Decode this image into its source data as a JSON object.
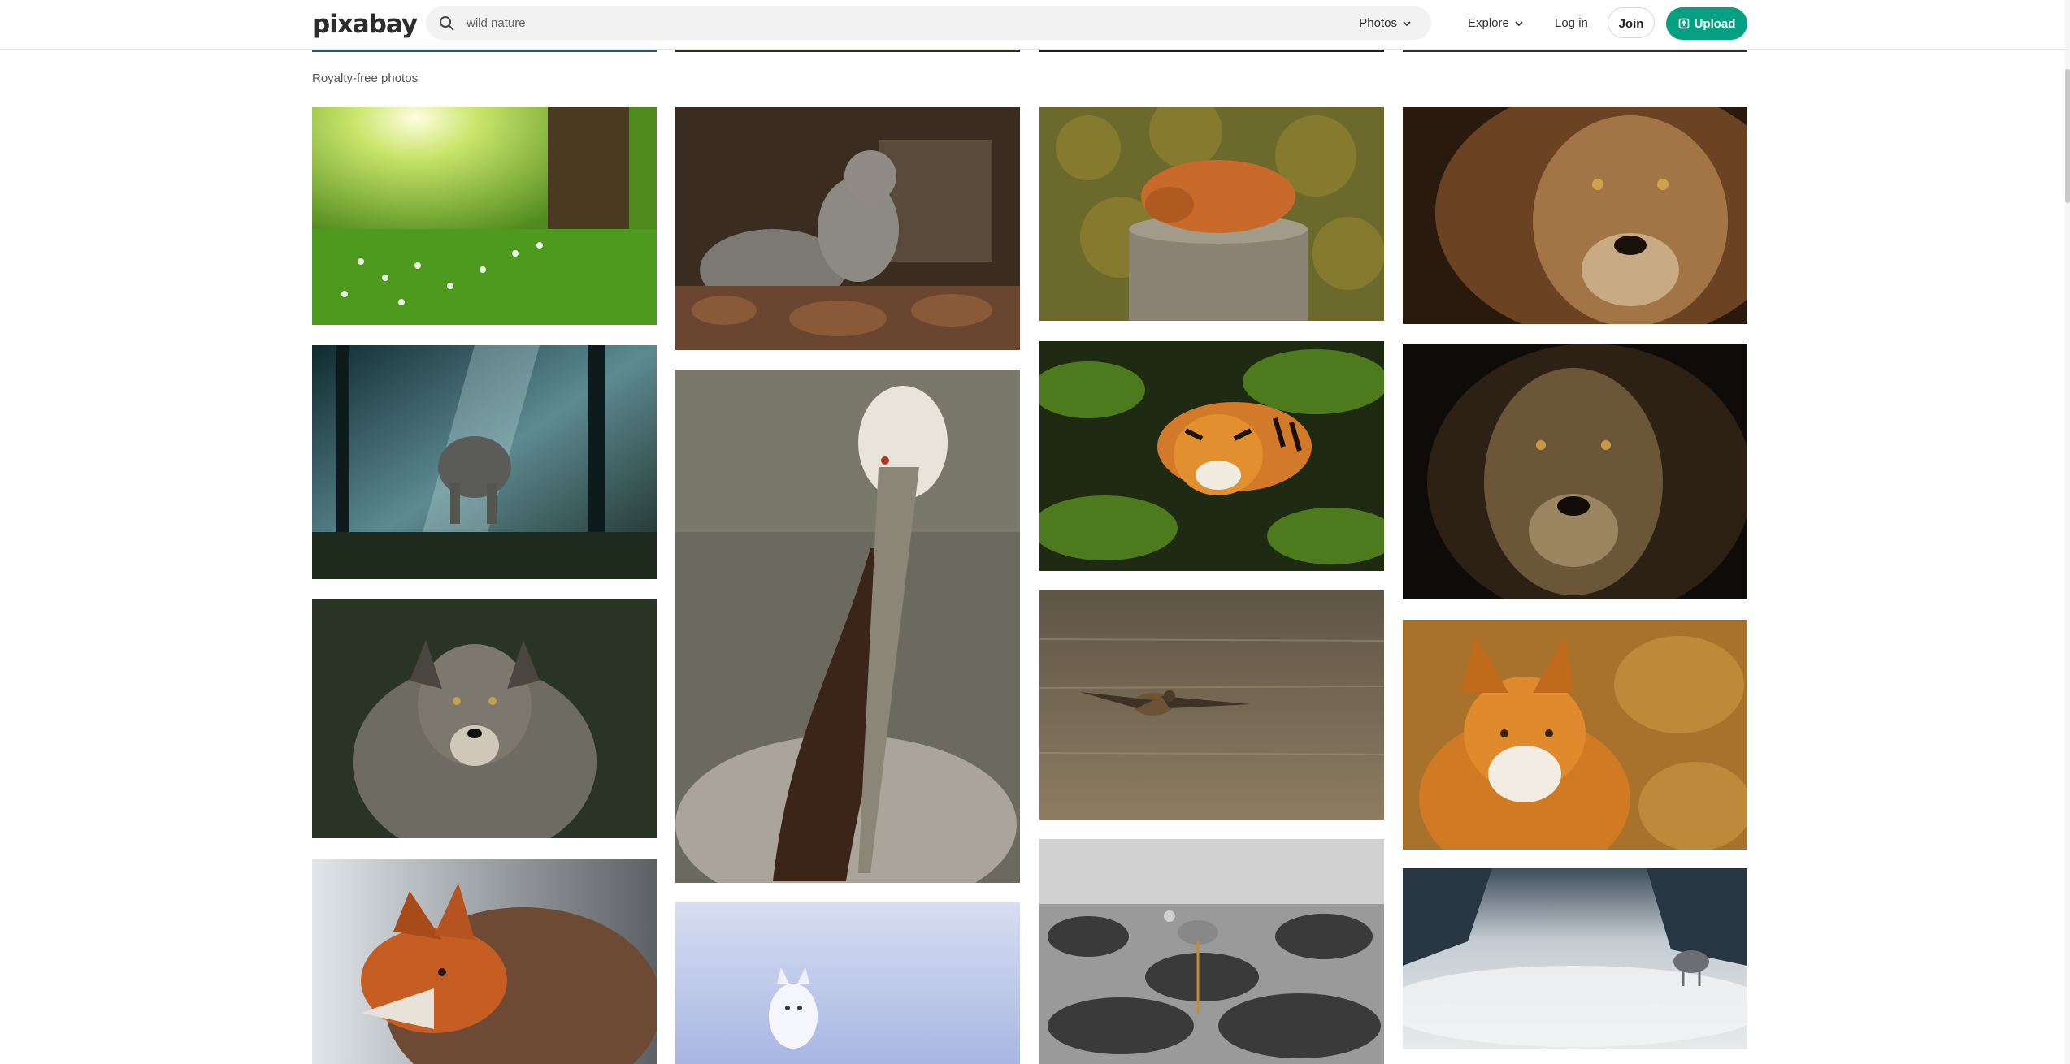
{
  "header": {
    "logo_text": "pixabay",
    "search": {
      "value": "",
      "placeholder": "wild nature",
      "type_label": "Photos"
    },
    "explore_label": "Explore",
    "login_label": "Log in",
    "join_label": "Join",
    "upload_label": "Upload"
  },
  "section": {
    "label": "Royalty-free photos"
  },
  "photos": [
    {
      "subject": "sunlit forest meadow with flowers"
    },
    {
      "subject": "squirrel eating in autumn leaves"
    },
    {
      "subject": "fox sleeping on a tree stump"
    },
    {
      "subject": "close-up of lion face"
    },
    {
      "subject": "elephant in misty forest"
    },
    {
      "subject": "brown pelican portrait"
    },
    {
      "subject": "tiger swimming in green water"
    },
    {
      "subject": "dark lion portrait"
    },
    {
      "subject": "grey wolf portrait"
    },
    {
      "subject": "duck flying over water"
    },
    {
      "subject": "red fox in golden grass"
    },
    {
      "subject": "red fox profile"
    },
    {
      "subject": "arctic fox in snow"
    },
    {
      "subject": "heron on rocks by the sea"
    },
    {
      "subject": "wolf in foggy mountains"
    }
  ],
  "colors": {
    "accent": "#05a081",
    "search_bg": "#f2f2f2"
  }
}
